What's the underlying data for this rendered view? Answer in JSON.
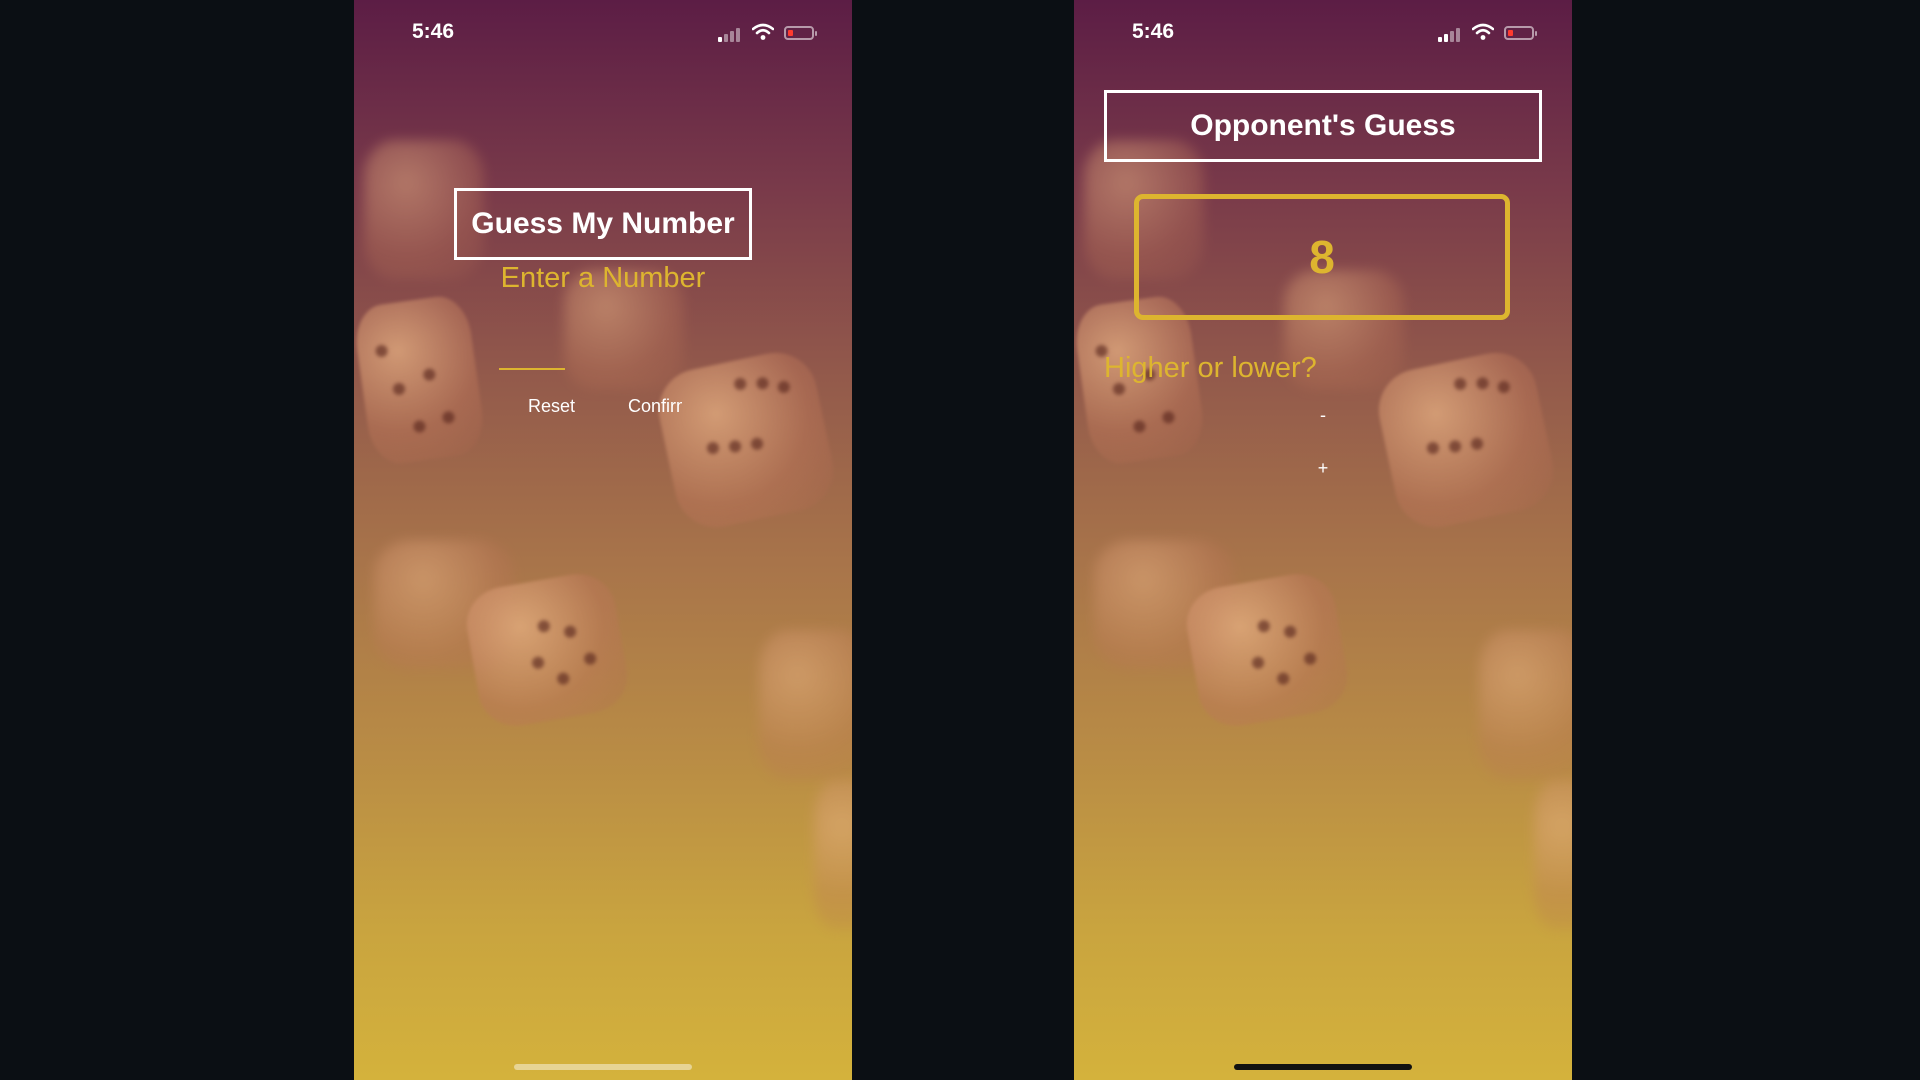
{
  "left_screen": {
    "status_bar": {
      "time": "5:46"
    },
    "title": "Guess My Number",
    "instruction": "Enter a Number",
    "input": {
      "value": "",
      "placeholder": ""
    },
    "buttons": {
      "reset": "Reset",
      "confirm": "Confirm"
    }
  },
  "right_screen": {
    "status_bar": {
      "time": "5:46"
    },
    "title": "Opponent's Guess",
    "guess_value": "8",
    "prompt": "Higher or lower?",
    "buttons": {
      "lower": "-",
      "higher": "+"
    }
  },
  "colors": {
    "accent": "#ddb52f",
    "title_border": "#ffffff",
    "gradient_top": "#5c1d45",
    "gradient_bottom": "#d4b23c",
    "battery_low": "#ff3b30"
  },
  "icons": [
    "signal-icon",
    "wifi-icon",
    "battery-icon"
  ]
}
